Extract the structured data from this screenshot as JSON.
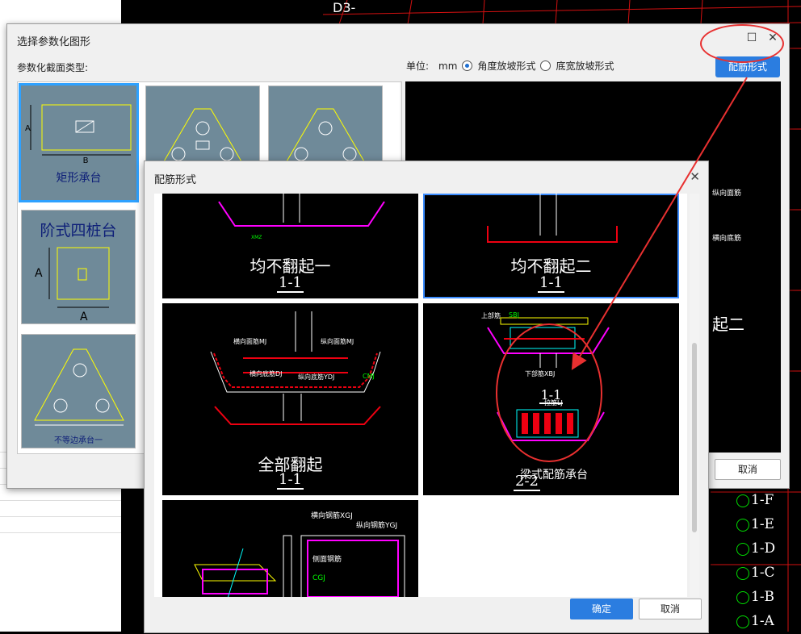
{
  "background": {
    "top_label": "D3-",
    "right_text": "起二",
    "axis_labels": [
      "1-F",
      "1-E",
      "1-D",
      "1-C",
      "1-B",
      "1-A"
    ],
    "small_labels": [
      "纵向面筋",
      "横向底筋"
    ]
  },
  "dialog_select": {
    "title": "选择参数化图形",
    "section_label": "参数化截面类型:",
    "unit_label": "单位:",
    "unit_value": "mm",
    "radio_angle": "角度放坡形式",
    "radio_width": "底宽放坡形式",
    "rebar_button": "配筋形式",
    "cancel_button": "取消",
    "thumbnails": [
      {
        "caption": "矩形承台",
        "selected": true
      },
      {
        "caption": "阶式四桩台"
      },
      {
        "caption": "不等边承台一"
      }
    ]
  },
  "dialog_rebar": {
    "title": "配筋形式",
    "ok_button": "确定",
    "cancel_button": "取消",
    "cards": [
      {
        "name": "均不翻起一",
        "section": "1-1"
      },
      {
        "name": "均不翻起二",
        "section": "1-1",
        "selected": true
      },
      {
        "name": "全部翻起",
        "section": "1-1",
        "labels": [
          "横向面筋MJ",
          "纵向面筋MJ",
          "横向底筋DJ",
          "纵向底筋YDJ",
          "CMJ"
        ]
      },
      {
        "name": "梁式配筋承台",
        "section_top": "1-1",
        "section": "2-2",
        "labels": [
          "上部筋",
          "SBJ",
          "下部筋XBJ",
          "拉筋LJ"
        ]
      },
      {
        "labels": [
          "横向钢筋XGJ",
          "纵向钢筋YGJ",
          "侧面钢筋",
          "CGJ"
        ]
      }
    ]
  },
  "accent_color": "#2b7de0",
  "annotation_color": "#e83030"
}
